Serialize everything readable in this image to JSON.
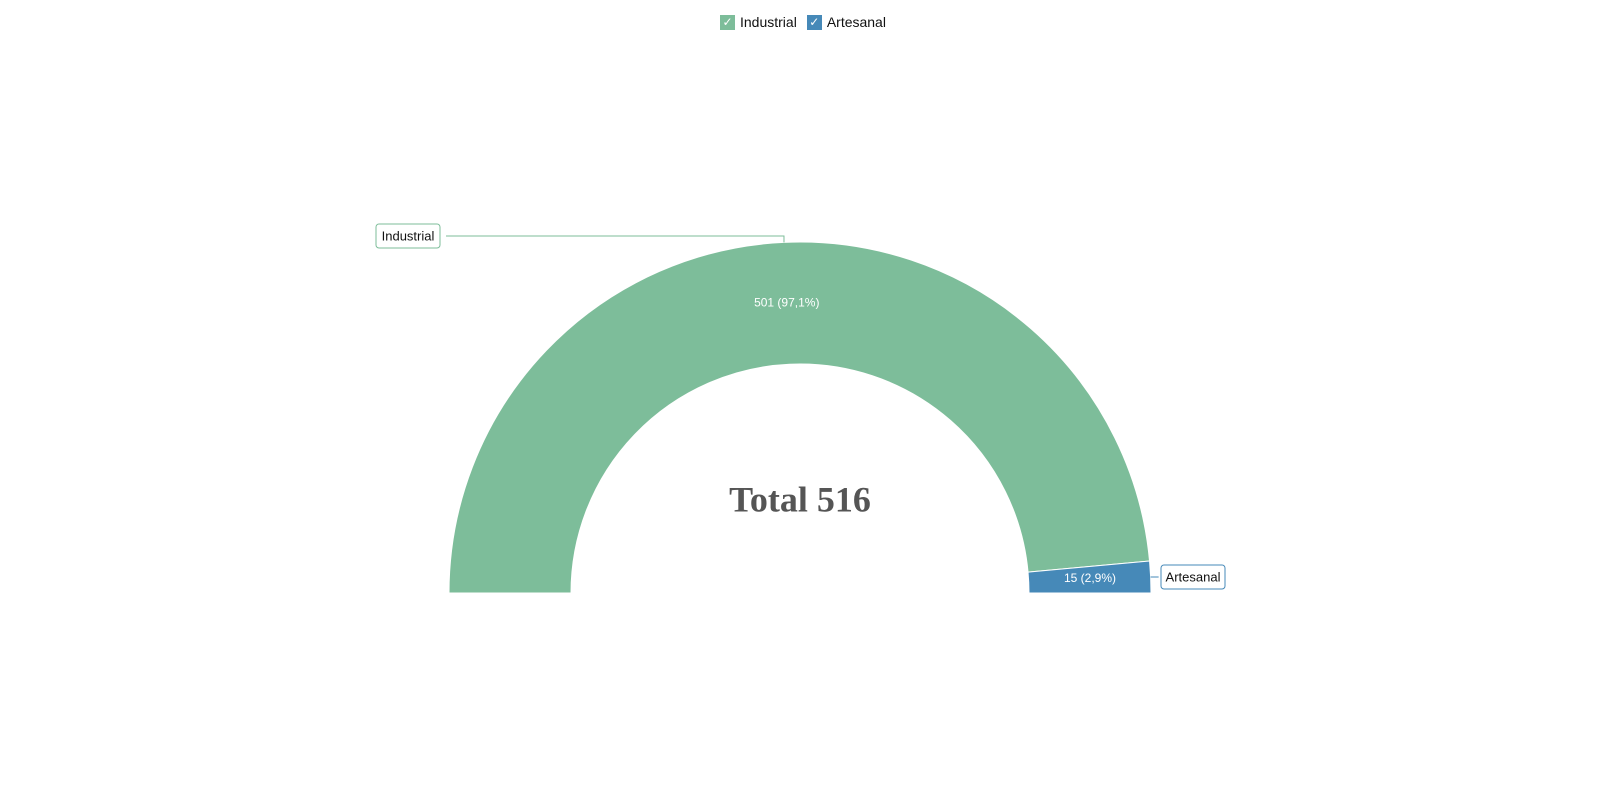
{
  "chart_data": {
    "type": "pie",
    "subtype": "semi-donut",
    "center_text": "Total 516",
    "legend": {
      "placement": "top-center",
      "items": [
        {
          "name": "Industrial",
          "color": "#7dbd9a",
          "checked": true,
          "check_icon": "checkmark-icon"
        },
        {
          "name": "Artesanal",
          "color": "#4689b8",
          "checked": true,
          "check_icon": "checkmark-icon"
        }
      ]
    },
    "slices": [
      {
        "name": "Industrial",
        "value": 501,
        "percent": 97.1,
        "value_label": "501 (97,1%)",
        "callout_label": "Industrial",
        "color": "#7dbd9a"
      },
      {
        "name": "Artesanal",
        "value": 15,
        "percent": 2.9,
        "value_label": "15 (2,9%)",
        "callout_label": "Artesanal",
        "color": "#4689b8"
      }
    ]
  }
}
